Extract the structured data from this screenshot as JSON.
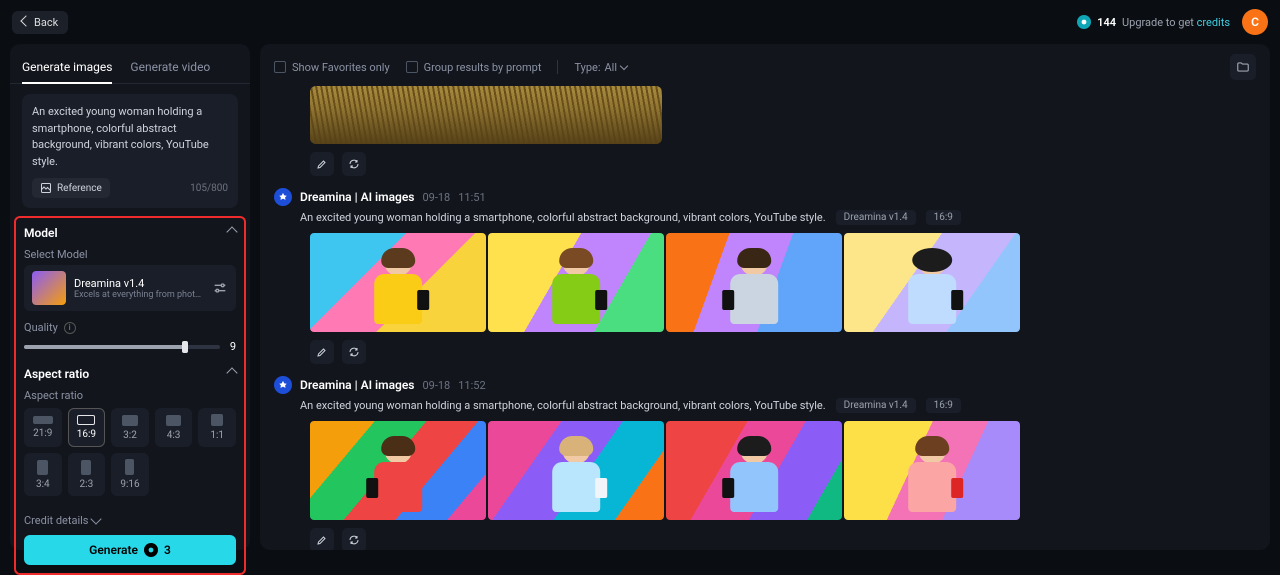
{
  "topbar": {
    "back": "Back",
    "credits": "144",
    "upgrade_prefix": "Upgrade to get ",
    "upgrade_link": "credits",
    "avatar_initial": "C"
  },
  "tabs": {
    "generate_images": "Generate images",
    "generate_video": "Generate video"
  },
  "prompt": {
    "text": "An excited young woman holding a smartphone, colorful abstract background, vibrant colors, YouTube style.",
    "reference": "Reference",
    "char_count": "105/800"
  },
  "model_section": {
    "title": "Model",
    "select_label": "Select Model",
    "model_name": "Dreamina v1.4",
    "model_desc": "Excels at everything from photoreali…",
    "quality_label": "Quality",
    "quality_value": "9"
  },
  "aspect_section": {
    "title": "Aspect ratio",
    "label": "Aspect ratio",
    "options_row1": [
      "21:9",
      "16:9",
      "3:2",
      "4:3",
      "1:1"
    ],
    "options_row2": [
      "3:4",
      "2:3",
      "9:16"
    ]
  },
  "credit_details": "Credit details",
  "generate": {
    "label": "Generate",
    "cost": "3"
  },
  "filters": {
    "favorites": "Show Favorites only",
    "group": "Group results by prompt",
    "type_label": "Type:",
    "type_value": "All"
  },
  "generations": [
    {
      "source": "Dreamina | AI images",
      "date": "09-18",
      "time": "11:51",
      "prompt": "An excited young woman holding a smartphone, colorful abstract background, vibrant colors, YouTube style.",
      "model_pill": "Dreamina v1.4",
      "ratio_pill": "16:9"
    },
    {
      "source": "Dreamina | AI images",
      "date": "09-18",
      "time": "11:52",
      "prompt": "An excited young woman holding a smartphone, colorful abstract background, vibrant colors, YouTube style.",
      "model_pill": "Dreamina v1.4",
      "ratio_pill": "16:9"
    }
  ]
}
